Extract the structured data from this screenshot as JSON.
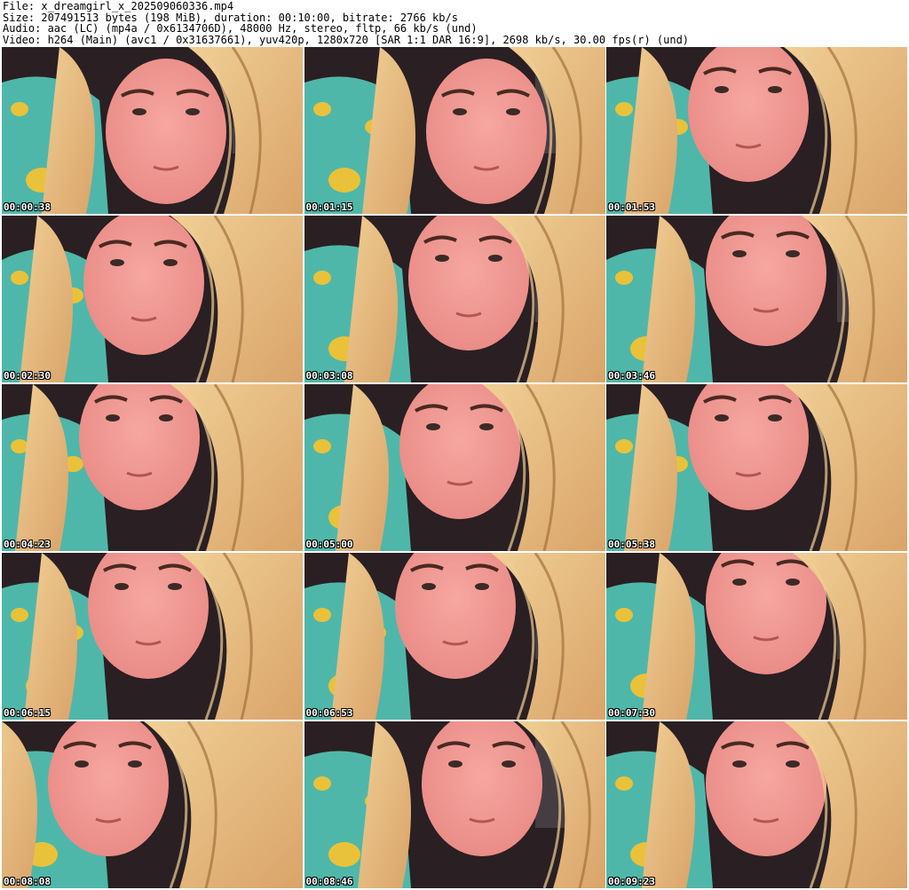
{
  "header": {
    "line1": "File: x_dreamgirl_x_202509060336.mp4",
    "line2": "Size: 207491513 bytes (198 MiB), duration: 00:10:00, bitrate: 2766 kb/s",
    "line3": "Audio: aac (LC) (mp4a / 0x6134706D), 48000 Hz, stereo, fltp, 66 kb/s (und)",
    "line4": "Video: h264 (Main) (avc1 / 0x31637661), yuv420p, 1280x720 [SAR 1:1 DAR 16:9], 2698 kb/s, 30.00 fps(r) (und)"
  },
  "thumbnails": [
    {
      "timestamp": "00:00:38"
    },
    {
      "timestamp": "00:01:15"
    },
    {
      "timestamp": "00:01:53"
    },
    {
      "timestamp": "00:02:30"
    },
    {
      "timestamp": "00:03:08"
    },
    {
      "timestamp": "00:03:46"
    },
    {
      "timestamp": "00:04:23"
    },
    {
      "timestamp": "00:05:00"
    },
    {
      "timestamp": "00:05:38"
    },
    {
      "timestamp": "00:06:15"
    },
    {
      "timestamp": "00:06:53"
    },
    {
      "timestamp": "00:07:30"
    },
    {
      "timestamp": "00:08:08"
    },
    {
      "timestamp": "00:08:46"
    },
    {
      "timestamp": "00:09:23"
    }
  ],
  "colors": {
    "skin": "#e98a86",
    "skin_highlight": "#f6a7a0",
    "hair": "#d9a46a",
    "hair_light": "#f0cf95",
    "pajama": "#4fb7a9",
    "duck": "#e9c23a",
    "background": "#2a1f22",
    "timestamp_text": "#ffffff"
  }
}
